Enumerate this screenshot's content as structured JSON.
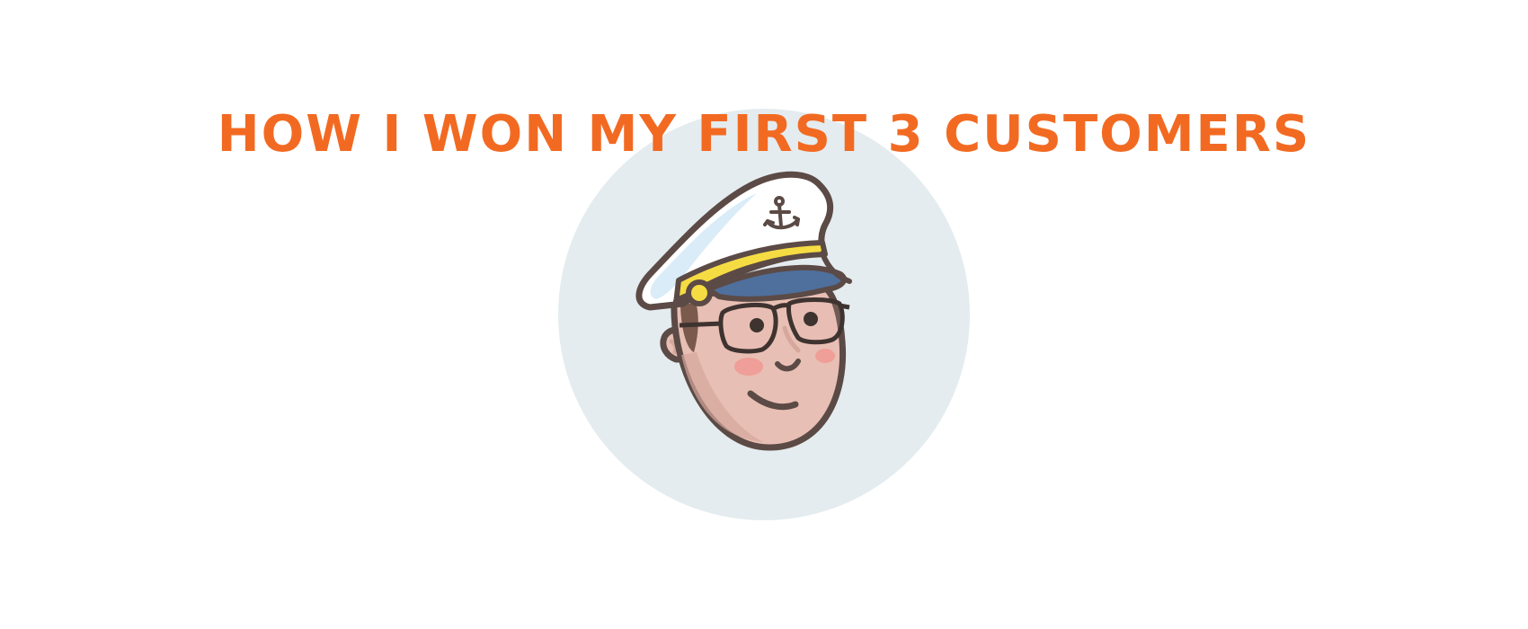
{
  "headline": {
    "text": "HOW I WON MY FIRST 3 CUSTOMERS",
    "color": "#f26a22"
  },
  "illustration": {
    "subject": "captain-avatar",
    "icons": [
      "captain-hat-icon",
      "anchor-icon",
      "glasses-icon"
    ],
    "colors": {
      "backdrop": "#e4ecef",
      "outline": "#5b4a45",
      "skin": "#e8bfb4",
      "skin_shadow": "#d6a79c",
      "cheek": "#ef9e98",
      "hat_white": "#ffffff",
      "hat_shadow": "#d9ecf8",
      "hat_band": "#f6dc43",
      "visor": "#4f6f9c",
      "hair": "#7a5a4c"
    }
  }
}
